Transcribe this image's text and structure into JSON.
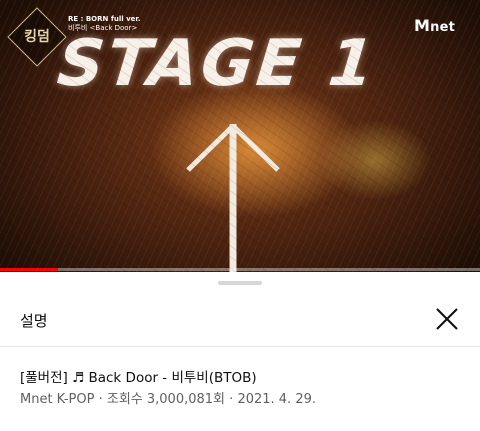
{
  "video": {
    "overlay_text": "STAGE 1",
    "show_logo_text": "킹덤",
    "caption_line1": "RE : BORN full ver.",
    "caption_line2": "비투비 <Back Door>",
    "channel_logo_text": "net",
    "channel_logo_m": "M",
    "progress": 0.12
  },
  "sheet": {
    "title": "설명",
    "close_icon": "close-icon",
    "video_title": "[풀버전] ♬ Back Door - 비투비(BTOB)",
    "channel": "Mnet K-POP",
    "separator": "·",
    "views": "조회수 3,000,081회",
    "date": "2021. 4. 29."
  },
  "colors": {
    "progress": "#ff0000",
    "sheet_bg": "#ffffff",
    "meta_text": "#606060"
  }
}
